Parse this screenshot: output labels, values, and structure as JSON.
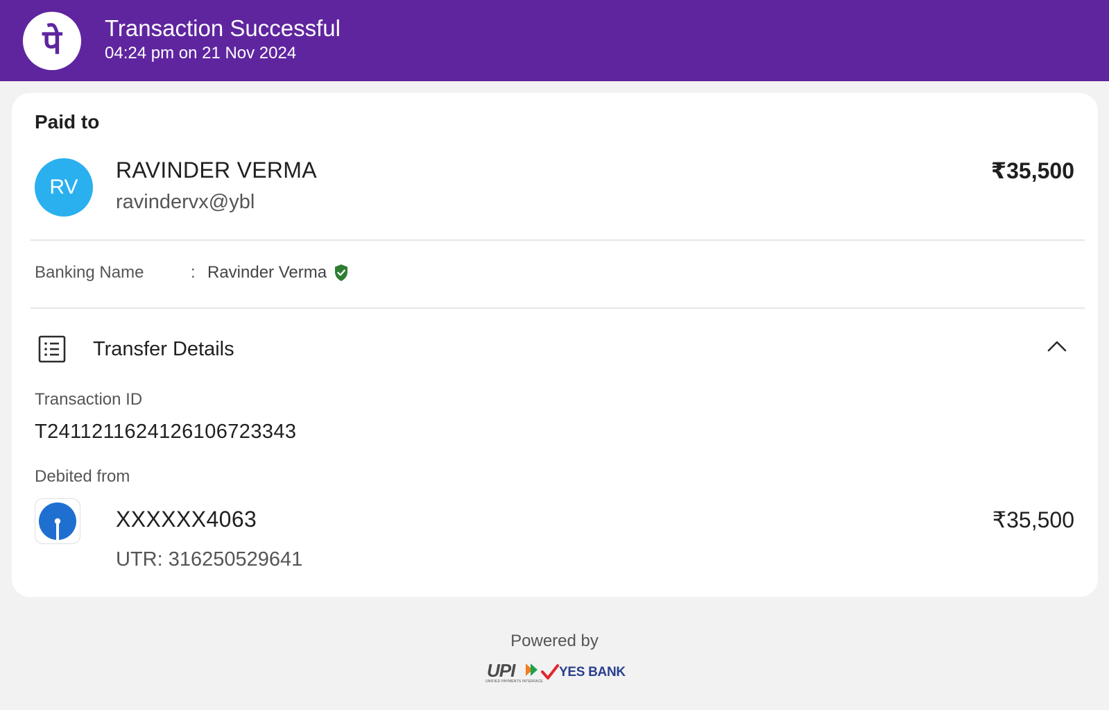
{
  "header": {
    "logo_glyph": "पे",
    "title": "Transaction Successful",
    "subtitle": "04:24 pm on 21 Nov 2024"
  },
  "payee": {
    "section_label": "Paid to",
    "initials": "RV",
    "name": "RAVINDER VERMA",
    "upi_id": "ravindervx@ybl",
    "amount": "₹35,500"
  },
  "banking": {
    "label": "Banking Name",
    "separator": ":",
    "value": "Ravinder Verma",
    "verified_icon": "shield-check-icon"
  },
  "transfer": {
    "title": "Transfer Details",
    "icon": "receipt-list-icon",
    "toggle_icon": "chevron-up-icon",
    "transaction_id_label": "Transaction ID",
    "transaction_id": "T2411211624126106723343",
    "debited_from_label": "Debited from",
    "account": "XXXXXX4063",
    "amount": "₹35,500",
    "utr": "UTR: 316250529641"
  },
  "footer": {
    "powered_by": "Powered by",
    "upi_logo_text": "UPI",
    "upi_tagline": "UNIFIED PAYMENTS INTERFACE",
    "bank_name": "YES BANK"
  },
  "colors": {
    "brand_purple": "#5f259f",
    "avatar_blue": "#2ab0ef",
    "verified_green": "#2e7d32",
    "sbi_blue": "#1f6fd1",
    "yes_bank_navy": "#2a3f8f",
    "yes_bank_red": "#e0262f"
  }
}
